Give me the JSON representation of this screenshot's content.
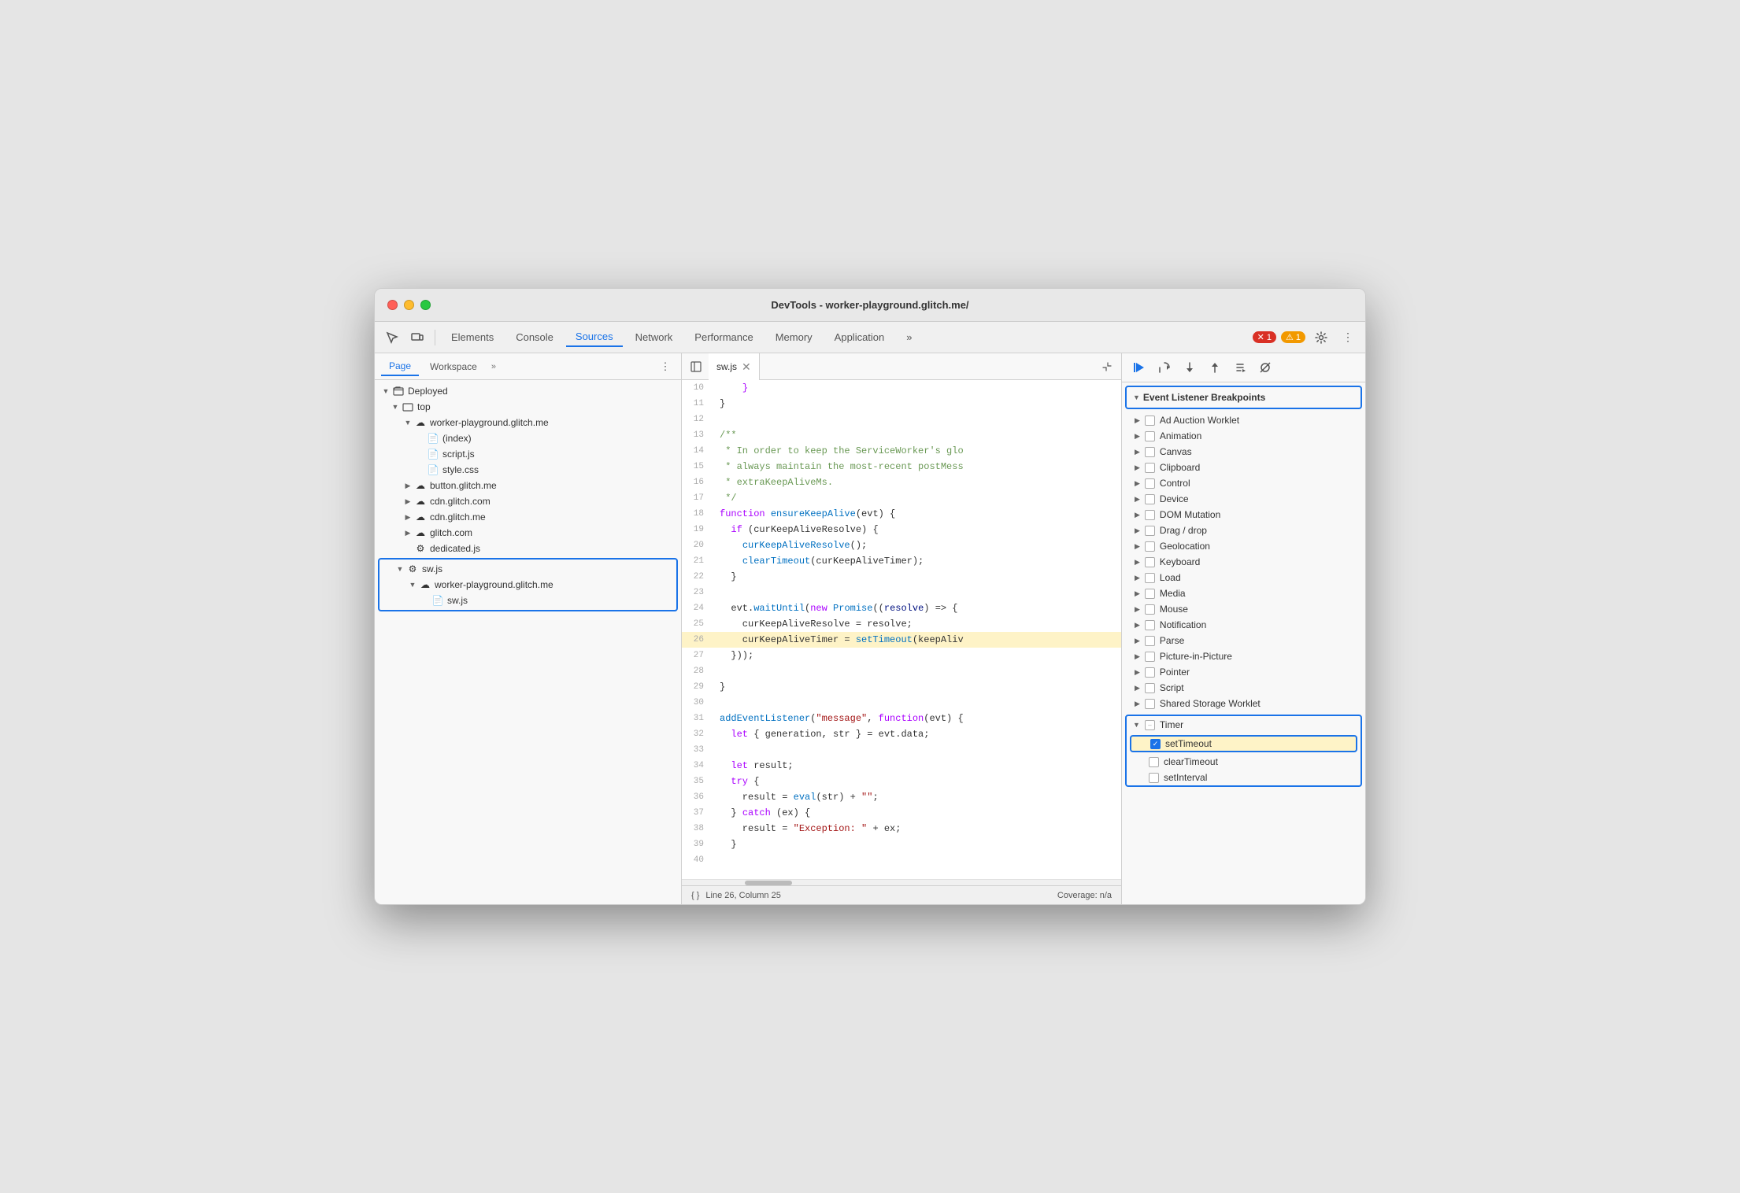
{
  "window": {
    "title": "DevTools - worker-playground.glitch.me/"
  },
  "toolbar": {
    "tabs": [
      "Elements",
      "Console",
      "Sources",
      "Network",
      "Performance",
      "Memory",
      "Application"
    ],
    "active_tab": "Sources",
    "error_count": "1",
    "warning_count": "1"
  },
  "sidebar": {
    "tabs": [
      "Page",
      "Workspace"
    ],
    "more_label": "»",
    "tree": [
      {
        "label": "Deployed",
        "type": "folder",
        "expanded": true,
        "depth": 0
      },
      {
        "label": "top",
        "type": "folder",
        "expanded": true,
        "depth": 1
      },
      {
        "label": "worker-playground.glitch.me",
        "type": "cloud",
        "expanded": true,
        "depth": 2
      },
      {
        "label": "(index)",
        "type": "file-html",
        "depth": 3
      },
      {
        "label": "script.js",
        "type": "file-js",
        "depth": 3
      },
      {
        "label": "style.css",
        "type": "file-css",
        "depth": 3
      },
      {
        "label": "button.glitch.me",
        "type": "cloud",
        "depth": 2
      },
      {
        "label": "cdn.glitch.com",
        "type": "cloud",
        "depth": 2
      },
      {
        "label": "cdn.glitch.me",
        "type": "cloud",
        "depth": 2
      },
      {
        "label": "glitch.com",
        "type": "cloud",
        "depth": 2
      },
      {
        "label": "dedicated.js",
        "type": "file-gear",
        "depth": 2
      },
      {
        "label": "sw.js",
        "type": "file-gear",
        "highlighted": true,
        "depth": 1
      },
      {
        "label": "worker-playground.glitch.me",
        "type": "cloud",
        "highlighted": true,
        "depth": 2
      },
      {
        "label": "sw.js",
        "type": "file-js2",
        "highlighted": true,
        "depth": 3
      }
    ]
  },
  "editor": {
    "filename": "sw.js",
    "lines": [
      {
        "num": 10,
        "content": "    }",
        "type": "normal"
      },
      {
        "num": 11,
        "content": "}",
        "type": "normal"
      },
      {
        "num": 12,
        "content": "",
        "type": "normal"
      },
      {
        "num": 13,
        "content": "/**",
        "type": "comment"
      },
      {
        "num": 14,
        "content": " * In order to keep the ServiceWorker's glo",
        "type": "comment"
      },
      {
        "num": 15,
        "content": " * always maintain the most-recent postMess",
        "type": "comment"
      },
      {
        "num": 16,
        "content": " * extraKeepAliveMs.",
        "type": "comment"
      },
      {
        "num": 17,
        "content": " */",
        "type": "comment"
      },
      {
        "num": 18,
        "content": "function ensureKeepAlive(evt) {",
        "type": "code"
      },
      {
        "num": 19,
        "content": "  if (curKeepAliveResolve) {",
        "type": "code"
      },
      {
        "num": 20,
        "content": "    curKeepAliveResolve();",
        "type": "code"
      },
      {
        "num": 21,
        "content": "    clearTimeout(curKeepAliveTimer);",
        "type": "code"
      },
      {
        "num": 22,
        "content": "  }",
        "type": "normal"
      },
      {
        "num": 23,
        "content": "",
        "type": "normal"
      },
      {
        "num": 24,
        "content": "  evt.waitUntil(new Promise((resolve) => {",
        "type": "code"
      },
      {
        "num": 25,
        "content": "    curKeepAliveResolve = resolve;",
        "type": "code"
      },
      {
        "num": 26,
        "content": "    curKeepAliveTimer = setTimeout(keepAliv",
        "type": "highlighted"
      },
      {
        "num": 27,
        "content": "  }));",
        "type": "normal"
      },
      {
        "num": 28,
        "content": "",
        "type": "normal"
      },
      {
        "num": 29,
        "content": "}",
        "type": "normal"
      },
      {
        "num": 30,
        "content": "",
        "type": "normal"
      },
      {
        "num": 31,
        "content": "addEventListener(\"message\", function(evt) {",
        "type": "code"
      },
      {
        "num": 32,
        "content": "  let { generation, str } = evt.data;",
        "type": "code"
      },
      {
        "num": 33,
        "content": "",
        "type": "normal"
      },
      {
        "num": 34,
        "content": "  let result;",
        "type": "code"
      },
      {
        "num": 35,
        "content": "  try {",
        "type": "code"
      },
      {
        "num": 36,
        "content": "    result = eval(str) + \"\";",
        "type": "code"
      },
      {
        "num": 37,
        "content": "  } catch (ex) {",
        "type": "code"
      },
      {
        "num": 38,
        "content": "    result = \"Exception: \" + ex;",
        "type": "code"
      },
      {
        "num": 39,
        "content": "  }",
        "type": "normal"
      },
      {
        "num": 40,
        "content": "",
        "type": "normal"
      }
    ],
    "status": {
      "line": "26",
      "column": "25",
      "coverage": "Coverage: n/a"
    }
  },
  "right_panel": {
    "section_title": "Event Listener Breakpoints",
    "categories": [
      "Ad Auction Worklet",
      "Animation",
      "Canvas",
      "Clipboard",
      "Control",
      "Device",
      "DOM Mutation",
      "Drag / drop",
      "Geolocation",
      "Keyboard",
      "Load",
      "Media",
      "Mouse",
      "Notification",
      "Parse",
      "Picture-in-Picture",
      "Pointer",
      "Script",
      "Shared Storage Worklet"
    ],
    "timer": {
      "label": "Timer",
      "items": [
        {
          "label": "setTimeout",
          "checked": true,
          "highlighted": true
        },
        {
          "label": "clearTimeout",
          "checked": false
        },
        {
          "label": "setInterval",
          "checked": false
        }
      ]
    }
  }
}
